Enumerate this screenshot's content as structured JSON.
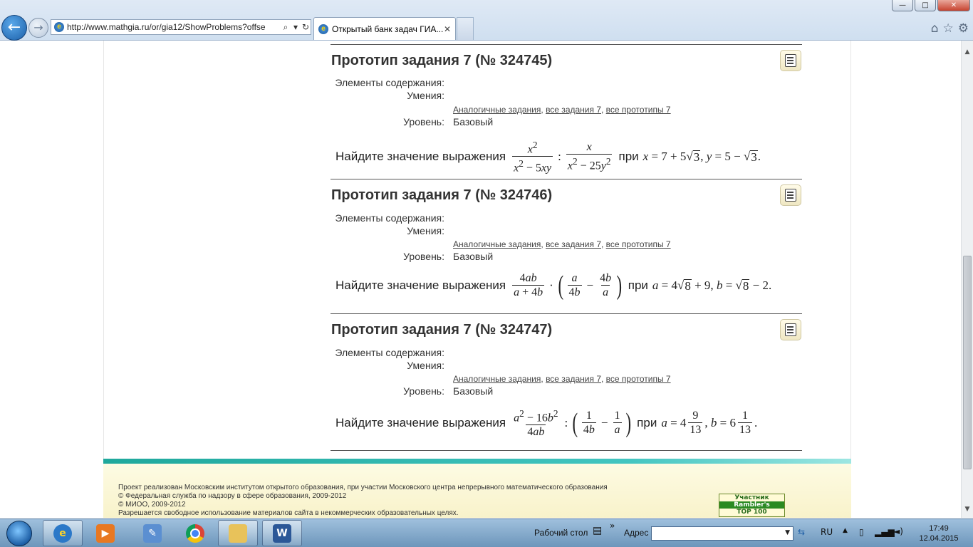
{
  "browser": {
    "url": "http://www.mathgia.ru/or/gia12/ShowProblems?offse",
    "tab_title": "Открытый банк задач ГИА...",
    "tab_close": "✕",
    "search_glyph": "⌕",
    "dropdown_glyph": "▾",
    "refresh_glyph": "↻",
    "back_glyph": "←",
    "forward_glyph": "→",
    "home_glyph": "⌂",
    "star_glyph": "☆",
    "gear_glyph": "⚙",
    "window": {
      "minimize": "—",
      "maximize": "□",
      "close": "✕"
    }
  },
  "problems": [
    {
      "title": "Прототип задания 7 (№ 324745)",
      "label_elements": "Элементы содержания:",
      "label_skills": "Умения:",
      "link_analog": "Аналогичные задания",
      "link_all": "все задания 7",
      "link_prototypes": "все прототипы 7",
      "label_level": "Уровень:",
      "level": "Базовый",
      "task_text": "Найдите значение выражения",
      "word_pri": "при"
    },
    {
      "title": "Прототип задания 7 (№ 324746)",
      "label_elements": "Элементы содержания:",
      "label_skills": "Умения:",
      "link_analog": "Аналогичные задания",
      "link_all": "все задания 7",
      "link_prototypes": "все прототипы 7",
      "label_level": "Уровень:",
      "level": "Базовый",
      "task_text": "Найдите значение выражения",
      "word_pri": "при"
    },
    {
      "title": "Прототип задания 7 (№ 324747)",
      "label_elements": "Элементы содержания:",
      "label_skills": "Умения:",
      "link_analog": "Аналогичные задания",
      "link_all": "все задания 7",
      "link_prototypes": "все прототипы 7",
      "label_level": "Уровень:",
      "level": "Базовый",
      "task_text": "Найдите значение выражения",
      "word_pri": "при"
    }
  ],
  "footer": {
    "line1": "Проект реализован Московским институтом открытого образования, при участии Московского центра непрерывного математического образования",
    "line2": "© Федеральная служба по надзору в сфере образования, 2009-2012",
    "line3": "© МИОО, 2009-2012",
    "line4": "Разрешается свободное использование материалов сайта в некоммерческих образовательных целях.",
    "rambler": [
      "Участник",
      "Rambler's",
      "TOP 100"
    ]
  },
  "taskbar": {
    "desktop_label": "Рабочий стол",
    "address_label": "Адрес",
    "chevron": "»",
    "lang": "RU",
    "time": "17:49",
    "date": "12.04.2015"
  },
  "colors": {
    "teal_band": "#1fa89c",
    "footer_bg": "#fdfbe3",
    "chrome_bg": "#dfe9f5"
  }
}
